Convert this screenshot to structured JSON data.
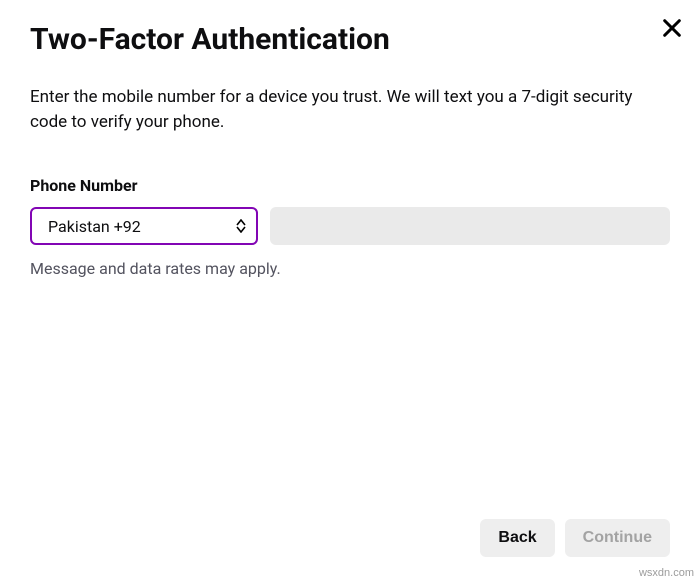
{
  "modal": {
    "title": "Two-Factor Authentication",
    "description": "Enter the mobile number for a device you trust. We will text you a 7-digit security code to verify your phone."
  },
  "phone": {
    "label": "Phone Number",
    "country_selected": "Pakistan +92",
    "input_value": "",
    "helper": "Message and data rates may apply."
  },
  "buttons": {
    "back": "Back",
    "continue": "Continue"
  },
  "watermark": "wsxdn.com"
}
